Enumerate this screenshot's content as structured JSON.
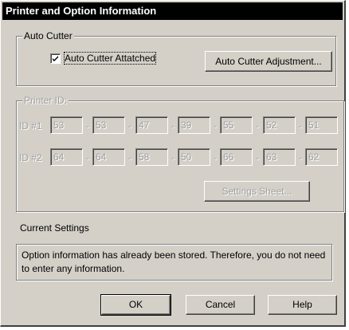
{
  "window": {
    "title": "Printer and Option Information"
  },
  "auto_cutter": {
    "group_label": "Auto Cutter",
    "checkbox_label": "Auto Cutter Attatched",
    "checked": true,
    "adjust_button": "Auto Cutter Adjustment..."
  },
  "printer_id": {
    "group_label": "Printer ID:",
    "rows": [
      {
        "label": "ID #1",
        "values": [
          "53",
          "53",
          "47",
          "39",
          "55",
          "52",
          "51"
        ]
      },
      {
        "label": "ID #2",
        "values": [
          "64",
          "64",
          "58",
          "50",
          "66",
          "63",
          "62"
        ]
      }
    ],
    "separator": "-",
    "settings_button": "Settings Sheet..."
  },
  "current_settings": {
    "heading": "Current Settings",
    "message": "Option information has already been stored. Therefore, you do not need to enter any information."
  },
  "buttons": {
    "ok": "OK",
    "cancel": "Cancel",
    "help": "Help"
  }
}
